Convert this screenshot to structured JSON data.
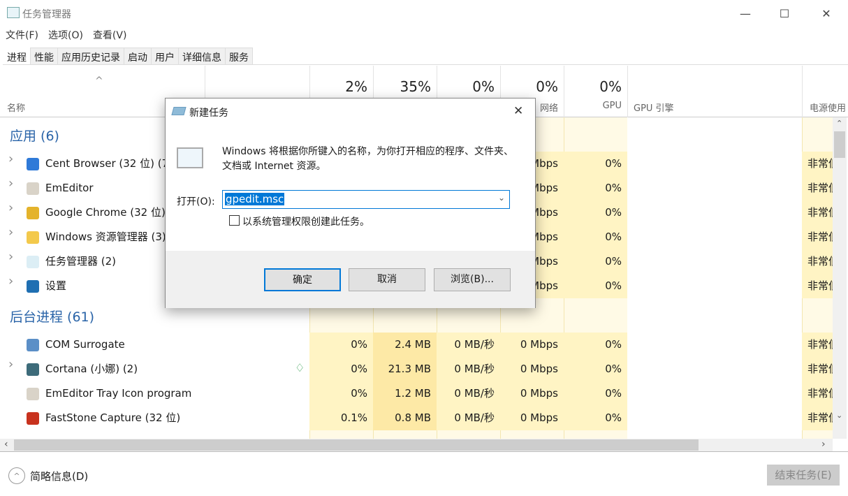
{
  "window": {
    "title": "任务管理器",
    "minimize": "—",
    "maximize": "☐",
    "close": "✕"
  },
  "menu": [
    "文件(F)",
    "选项(O)",
    "查看(V)"
  ],
  "tabs": [
    "进程",
    "性能",
    "应用历史记录",
    "启动",
    "用户",
    "详细信息",
    "服务"
  ],
  "active_tab": "进程",
  "columns": {
    "name": "名称",
    "cpu_pct": "2%",
    "mem_pct": "35%",
    "disk_pct": "0%",
    "net_pct": "0%",
    "net": "网络",
    "gpu_pct": "0%",
    "gpu": "GPU",
    "gpu_engine": "GPU 引擎",
    "power": "电源使用"
  },
  "groups": {
    "apps": {
      "label": "应用 (6)",
      "rows": [
        {
          "name": "Cent Browser (32 位) (7)",
          "icon": "cent-browser-icon",
          "net": "0 Mbps",
          "gpu": "0%",
          "power": "非常低"
        },
        {
          "name": "EmEditor",
          "icon": "emeditor-icon",
          "net": "0 Mbps",
          "gpu": "0%",
          "power": "非常低"
        },
        {
          "name": "Google Chrome (32 位)",
          "icon": "chrome-icon",
          "net": "0 Mbps",
          "gpu": "0%",
          "power": "非常低"
        },
        {
          "name": "Windows 资源管理器 (3)",
          "icon": "explorer-icon",
          "net": "0 Mbps",
          "gpu": "0%",
          "power": "非常低"
        },
        {
          "name": "任务管理器 (2)",
          "icon": "task-manager-icon",
          "net": "0 Mbps",
          "gpu": "0%",
          "power": "非常低"
        },
        {
          "name": "设置",
          "icon": "settings-icon",
          "net": "0 Mbps",
          "gpu": "0%",
          "power": "非常低"
        }
      ]
    },
    "background": {
      "label": "后台进程 (61)",
      "rows": [
        {
          "name": "COM Surrogate",
          "icon": "com-surrogate-icon",
          "expand": false,
          "cpu": "0%",
          "mem": "2.4 MB",
          "disk": "0 MB/秒",
          "net": "0 Mbps",
          "gpu": "0%",
          "power": "非常低"
        },
        {
          "name": "Cortana (小娜) (2)",
          "icon": "cortana-icon",
          "expand": true,
          "leaf": true,
          "cpu": "0%",
          "mem": "21.3 MB",
          "disk": "0 MB/秒",
          "net": "0 Mbps",
          "gpu": "0%",
          "power": "非常低"
        },
        {
          "name": "EmEditor Tray Icon program",
          "icon": "emeditor-icon",
          "expand": false,
          "cpu": "0%",
          "mem": "1.2 MB",
          "disk": "0 MB/秒",
          "net": "0 Mbps",
          "gpu": "0%",
          "power": "非常低"
        },
        {
          "name": "FastStone Capture (32 位)",
          "icon": "faststone-icon",
          "expand": false,
          "cpu": "0.1%",
          "mem": "0.8 MB",
          "disk": "0 MB/秒",
          "net": "0 Mbps",
          "gpu": "0%",
          "power": "非常低"
        }
      ]
    }
  },
  "footer": {
    "less_details": "简略信息(D)",
    "end_task": "结束任务(E)"
  },
  "dialog": {
    "title": "新建任务",
    "message": "Windows 将根据你所键入的名称，为你打开相应的程序、文件夹、文档或 Internet 资源。",
    "open_label": "打开(O):",
    "open_value": "gpedit.msc",
    "admin_checkbox": "以系统管理权限创建此任务。",
    "admin_checked": false,
    "ok": "确定",
    "cancel": "取消",
    "browse": "浏览(B)..."
  },
  "colors": {
    "accent": "#2a64a8",
    "heat_light": "#fff4c4",
    "heat_medium": "#fde9a6",
    "selection": "#0078d7"
  }
}
